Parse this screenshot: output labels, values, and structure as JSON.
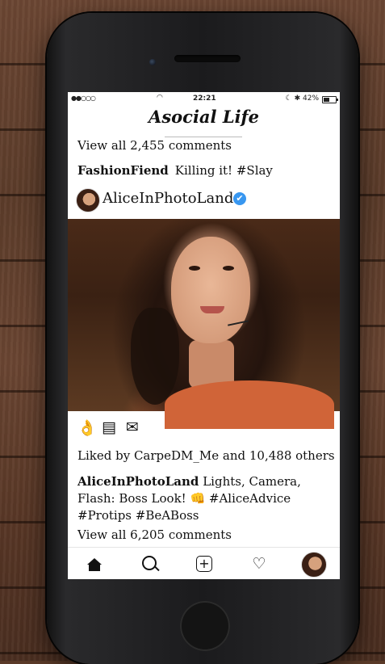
{
  "status_bar": {
    "signal": "●●○○○",
    "time": "22:21",
    "right_status": "☾ ✱ 42%",
    "battery_percent": 42
  },
  "app": {
    "title": "Asocial Life"
  },
  "feed": {
    "view_all_top": "View all 2,455 comments",
    "top_comment": {
      "user": "FashionFiend",
      "text": "Killing it! #Slay"
    },
    "post": {
      "username": "AliceInPhotoLand",
      "verified_icon": "✔",
      "actions": {
        "like_icon": "👌",
        "comment_icon": "▤",
        "share_icon": "✉"
      },
      "liked_by": "Liked by CarpeDM_Me and 10,488 others",
      "caption_user": "AliceInPhotoLand",
      "caption_text": "Lights, Camera, Flash: Boss Look! 👊 #AliceAdvice #Protips #BeABoss",
      "view_all_bottom": "View all 6,205 comments"
    }
  },
  "nav": {
    "items": [
      "home-icon",
      "search-icon",
      "add-post-icon",
      "heart-icon",
      "profile-avatar"
    ],
    "add_symbol": "+",
    "heart_symbol": "♡"
  },
  "colors": {
    "verified": "#3897f0",
    "muted_text": "#8a8a8a"
  }
}
